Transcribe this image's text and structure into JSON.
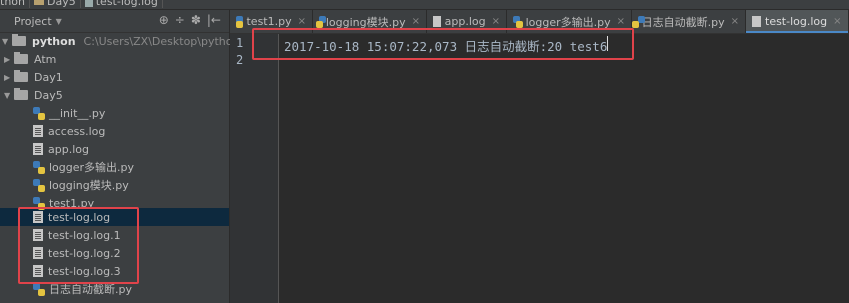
{
  "breadcrumb": {
    "items": [
      "thon",
      "Day5",
      "test-log.log"
    ]
  },
  "project": {
    "title": "Project",
    "tools": [
      "⊕",
      "÷",
      "✽",
      "|←"
    ]
  },
  "tree": {
    "root": {
      "name": "python",
      "path": "C:\\Users\\ZX\\Desktop\\python"
    },
    "folders": [
      "Atm",
      "Day1",
      "Day5"
    ],
    "files": [
      {
        "name": "__init__.py",
        "type": "py"
      },
      {
        "name": "access.log",
        "type": "log"
      },
      {
        "name": "app.log",
        "type": "log"
      },
      {
        "name": "logger多输出.py",
        "type": "py"
      },
      {
        "name": "logging模块.py",
        "type": "py"
      },
      {
        "name": "test1.py",
        "type": "py"
      },
      {
        "name": "test-log.log",
        "type": "log"
      },
      {
        "name": "test-log.log.1",
        "type": "log"
      },
      {
        "name": "test-log.log.2",
        "type": "log"
      },
      {
        "name": "test-log.log.3",
        "type": "log"
      },
      {
        "name": "日志自动截断.py",
        "type": "py"
      }
    ]
  },
  "tabs": [
    {
      "label": "test1.py",
      "close": "×"
    },
    {
      "label": "logging模块.py",
      "close": "×"
    },
    {
      "label": "app.log",
      "close": "×"
    },
    {
      "label": "logger多输出.py",
      "close": "×"
    },
    {
      "label": "日志自动截断.py",
      "close": "×"
    },
    {
      "label": "test-log.log",
      "close": "×"
    }
  ],
  "editor": {
    "line_numbers": [
      "1",
      "2"
    ],
    "line1": "2017-10-18 15:07:22,073 日志自动截断:20 test6"
  },
  "colors": {
    "highlight_box": "#e0434a",
    "selection": "#0d293e",
    "active_tab_underline": "#4a88c7"
  }
}
